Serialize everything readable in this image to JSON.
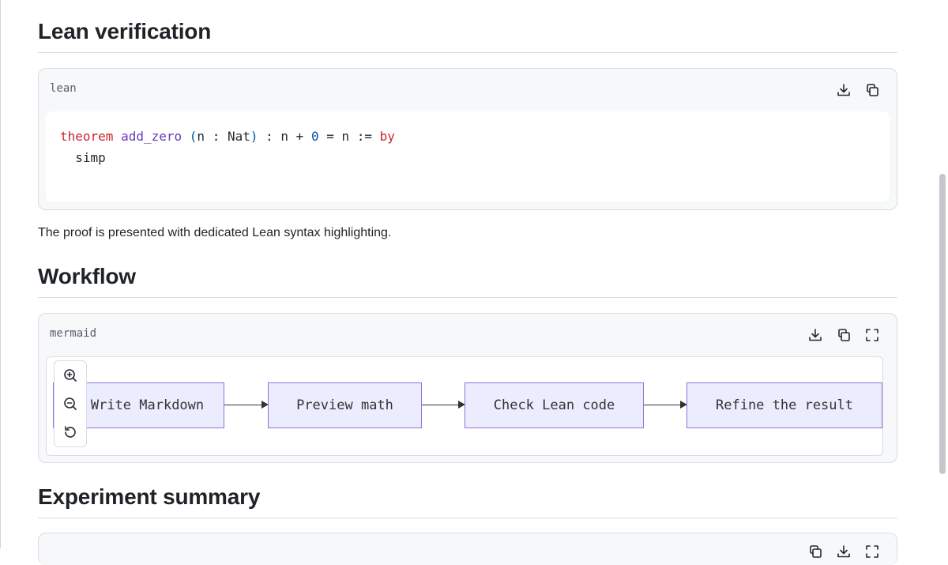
{
  "lean_section": {
    "heading": "Lean verification",
    "language_label": "lean",
    "code_line1": {
      "kw_theorem": "theorem",
      "name": "add_zero",
      "open_paren": "(",
      "binder": "n : Nat",
      "close_paren": ")",
      "type_lhs": " : n + ",
      "zero": "0",
      "type_rhs": " = n := ",
      "kw_by": "by"
    },
    "code_line2": "  simp",
    "description": "The proof is presented with dedicated Lean syntax highlighting."
  },
  "workflow_section": {
    "heading": "Workflow",
    "language_label": "mermaid",
    "nodes": [
      {
        "label": "Write Markdown"
      },
      {
        "label": "Preview math"
      },
      {
        "label": "Check Lean code"
      },
      {
        "label": "Refine the result"
      }
    ]
  },
  "summary_section": {
    "heading": "Experiment summary"
  },
  "icons": {
    "download": "download-icon",
    "copy": "copy-icon",
    "fullscreen": "fullscreen-icon",
    "zoom_in": "zoom-in-icon",
    "zoom_out": "zoom-out-icon",
    "reset": "reset-icon"
  },
  "colors": {
    "keyword": "#cf222e",
    "function": "#6639ba",
    "punctuation": "#0550ae",
    "node_fill": "#ececff",
    "node_border": "#9370db"
  }
}
